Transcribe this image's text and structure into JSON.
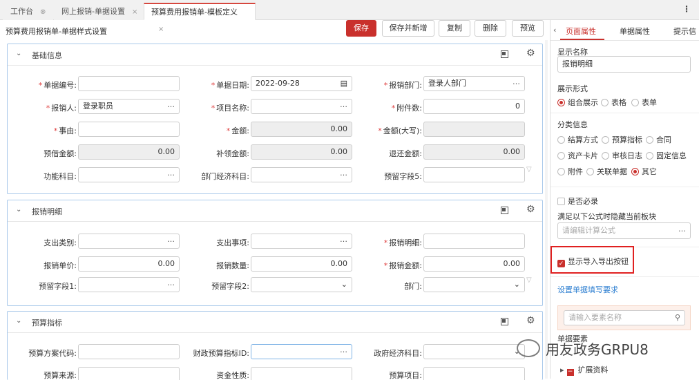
{
  "tabs": [
    {
      "label": "工作台",
      "close": "⊗"
    },
    {
      "label": "网上报销-单据设置",
      "close": "×"
    },
    {
      "label": "预算费用报销单-模板定义",
      "close": "×"
    }
  ],
  "page_title": "预算费用报销单-单据样式设置",
  "toolbar": {
    "save": "保存",
    "save_new": "保存并新增",
    "copy": "复制",
    "delete": "删除",
    "preview": "预览"
  },
  "panels": {
    "basic": {
      "title": "基础信息",
      "fields": [
        {
          "label": "单据编号:",
          "req": "*",
          "value": ""
        },
        {
          "label": "单据日期:",
          "req": "*",
          "value": "2022-09-28"
        },
        {
          "label": "报销部门:",
          "req": "*",
          "value": "登录人部门"
        },
        {
          "label": "报销人:",
          "req": "*",
          "value": "登录职员"
        },
        {
          "label": "项目名称:",
          "req": "*",
          "value": ""
        },
        {
          "label": "附件数:",
          "req": "*",
          "value": "0"
        },
        {
          "label": "事由:",
          "req": "*",
          "value": ""
        },
        {
          "label": "金额:",
          "req": "*",
          "value": "0.00"
        },
        {
          "label": "金额(大写):",
          "req": "*",
          "value": ""
        },
        {
          "label": "预借金额:",
          "req": "",
          "value": "0.00"
        },
        {
          "label": "补领金额:",
          "req": "",
          "value": "0.00"
        },
        {
          "label": "退还金额:",
          "req": "",
          "value": "0.00"
        },
        {
          "label": "功能科目:",
          "req": "",
          "value": ""
        },
        {
          "label": "部门经济科目:",
          "req": "",
          "value": ""
        },
        {
          "label": "预留字段5:",
          "req": "",
          "value": ""
        }
      ]
    },
    "detail": {
      "title": "报销明细",
      "fields": [
        {
          "label": "支出类别:",
          "req": "",
          "value": ""
        },
        {
          "label": "支出事项:",
          "req": "",
          "value": ""
        },
        {
          "label": "报销明细:",
          "req": "*",
          "value": ""
        },
        {
          "label": "报销单价:",
          "req": "",
          "value": "0.00"
        },
        {
          "label": "报销数量:",
          "req": "",
          "value": "0.00"
        },
        {
          "label": "报销金额:",
          "req": "*",
          "value": "0.00"
        },
        {
          "label": "预留字段1:",
          "req": "",
          "value": ""
        },
        {
          "label": "预留字段2:",
          "req": "",
          "value": ""
        },
        {
          "label": "部门:",
          "req": "",
          "value": ""
        }
      ]
    },
    "budget": {
      "title": "预算指标",
      "fields": [
        {
          "label": "预算方案代码:",
          "req": "",
          "value": ""
        },
        {
          "label": "财政预算指标ID:",
          "req": "",
          "value": ""
        },
        {
          "label": "政府经济科目:",
          "req": "",
          "value": ""
        },
        {
          "label": "预算来源:",
          "req": "",
          "value": ""
        },
        {
          "label": "资金性质:",
          "req": "",
          "value": ""
        },
        {
          "label": "预算项目:",
          "req": "",
          "value": ""
        }
      ]
    }
  },
  "right": {
    "tabs": [
      "页面属性",
      "单据属性",
      "提示信"
    ],
    "display_name_label": "显示名称",
    "display_name_value": "报销明细",
    "display_form_label": "展示形式",
    "display_forms": [
      "组合展示",
      "表格",
      "表单"
    ],
    "category_label": "分类信息",
    "categories": [
      "结算方式",
      "预算指标",
      "合同",
      "资产卡片",
      "审核日志",
      "固定信息",
      "附件",
      "关联单据",
      "其它"
    ],
    "required_label": "是否必录",
    "formula_label": "满足以下公式时隐藏当前板块",
    "formula_placeholder": "请编辑计算公式",
    "import_export_label": "显示导入导出按钮",
    "fill_req_link": "设置单据填写要求",
    "search_placeholder": "请输入要素名称",
    "elements_label": "单据要素",
    "tree_item": "扩展资料"
  },
  "watermark": "用友政务GRPU8",
  "colors": {
    "accent": "#c9302c",
    "link": "#2e7fd1",
    "panel_border": "#a9c9ea"
  }
}
